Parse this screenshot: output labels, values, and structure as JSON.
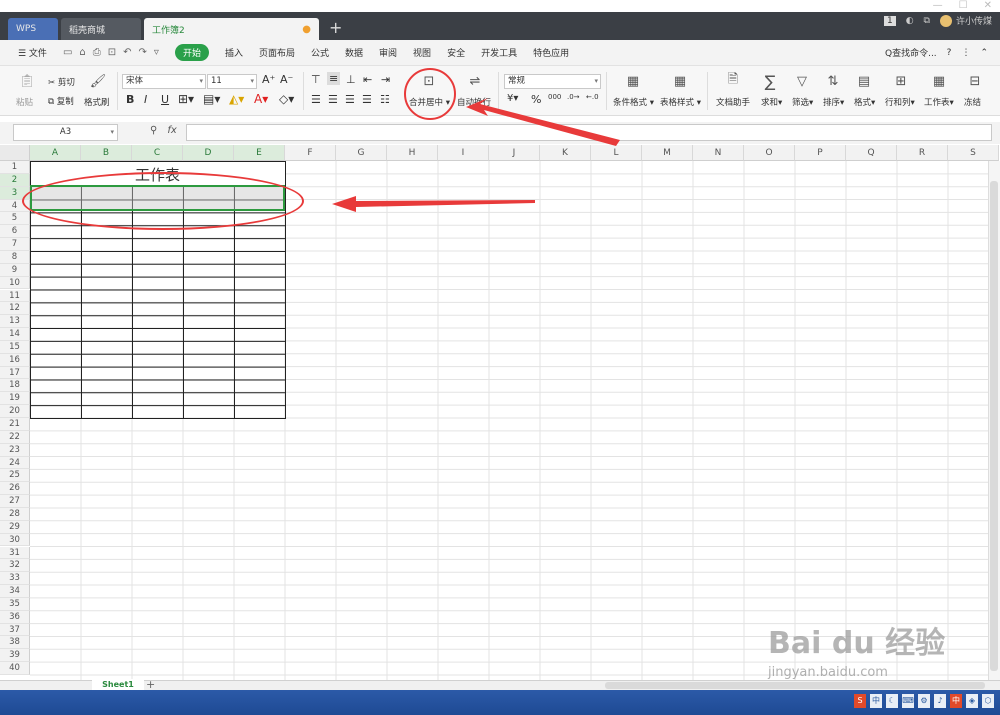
{
  "titlebar": {
    "tabs": [
      {
        "label": "WPS"
      },
      {
        "label": "稻壳商城"
      },
      {
        "label": "工作簿2"
      }
    ],
    "add_tab": "+",
    "badge": "1",
    "user": "许小传煤",
    "window_buttons": [
      "—",
      "☐",
      "✕"
    ]
  },
  "menubar": {
    "file": "☰ 文件",
    "items": [
      "开始",
      "插入",
      "页面布局",
      "公式",
      "数据",
      "审阅",
      "视图",
      "安全",
      "开发工具",
      "特色应用"
    ],
    "search": "Q查找命令...",
    "help": "?"
  },
  "ribbon": {
    "paste": "粘贴",
    "cut": "剪切",
    "copy": "复制",
    "format_painter": "格式刷",
    "font_name": "宋体",
    "font_size": "11",
    "merge_center": "合并居中",
    "wrap_text": "自动换行",
    "number_format": "常规",
    "conditional_format": "条件格式",
    "table_style": "表格样式",
    "doc_helper": "文档助手",
    "sum": "求和",
    "filter": "筛选",
    "sort": "排序",
    "format": "格式",
    "row_col": "行和列",
    "worksheet": "工作表",
    "freeze": "冻结"
  },
  "formulabar": {
    "name_box": "A3",
    "fx": "fx"
  },
  "sheet": {
    "title_cell": "工作表",
    "columns": [
      "A",
      "B",
      "C",
      "D",
      "E",
      "F",
      "G",
      "H",
      "I",
      "J",
      "K",
      "L",
      "M",
      "N",
      "O",
      "P",
      "Q",
      "R",
      "S"
    ],
    "rows": [
      "1",
      "2",
      "3",
      "4",
      "5",
      "6",
      "7",
      "8",
      "9",
      "10",
      "11",
      "12",
      "13",
      "14",
      "15",
      "16",
      "17",
      "18",
      "19",
      "20",
      "21",
      "22",
      "23",
      "24",
      "25",
      "26",
      "27",
      "28",
      "29",
      "30",
      "31",
      "32",
      "33",
      "34",
      "35",
      "36",
      "37",
      "38",
      "39",
      "40"
    ]
  },
  "sheettabs": {
    "active": "Sheet1",
    "add": "+"
  },
  "watermark": {
    "brand": "Bai du 经验",
    "url": "jingyan.baidu.com"
  },
  "colors": {
    "accent_green": "#2aa04a",
    "annotation_red": "#e83a3a",
    "titlebar": "#3b3f45"
  }
}
